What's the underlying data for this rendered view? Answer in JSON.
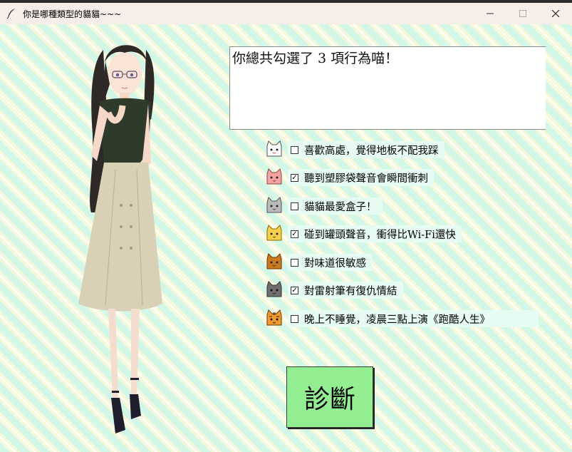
{
  "window": {
    "title": "你是哪種類型的貓貓~~~"
  },
  "result": {
    "text": "你總共勾選了 3 項行為喵！"
  },
  "behaviors": [
    {
      "label": "喜歡高處，覺得地板不配我踩",
      "checked": false,
      "icon": "white-cat-icon"
    },
    {
      "label": "聽到塑膠袋聲音會瞬間衝刺",
      "checked": true,
      "icon": "pink-cat-icon"
    },
    {
      "label": "貓貓最愛盒子！",
      "checked": false,
      "icon": "gray-cat-icon"
    },
    {
      "label": "碰到罐頭聲音，衝得比Wi-Fi還快",
      "checked": true,
      "icon": "yellow-cat-icon"
    },
    {
      "label": "對味道很敏感",
      "checked": false,
      "icon": "brown-cat-icon"
    },
    {
      "label": "對雷射筆有復仇情結",
      "checked": true,
      "icon": "dark-gray-cat-icon"
    },
    {
      "label": "晚上不睡覺，凌晨三點上演《跑酷人生》",
      "checked": false,
      "icon": "tiger-cat-icon"
    }
  ],
  "diagnose_button": {
    "label": "診斷"
  },
  "colors": {
    "background_stripe_mint": "#d2f7e6",
    "background_stripe_cream": "#f6f8dc",
    "button_green": "#93ee92",
    "titlebar": "#f6eee9"
  }
}
